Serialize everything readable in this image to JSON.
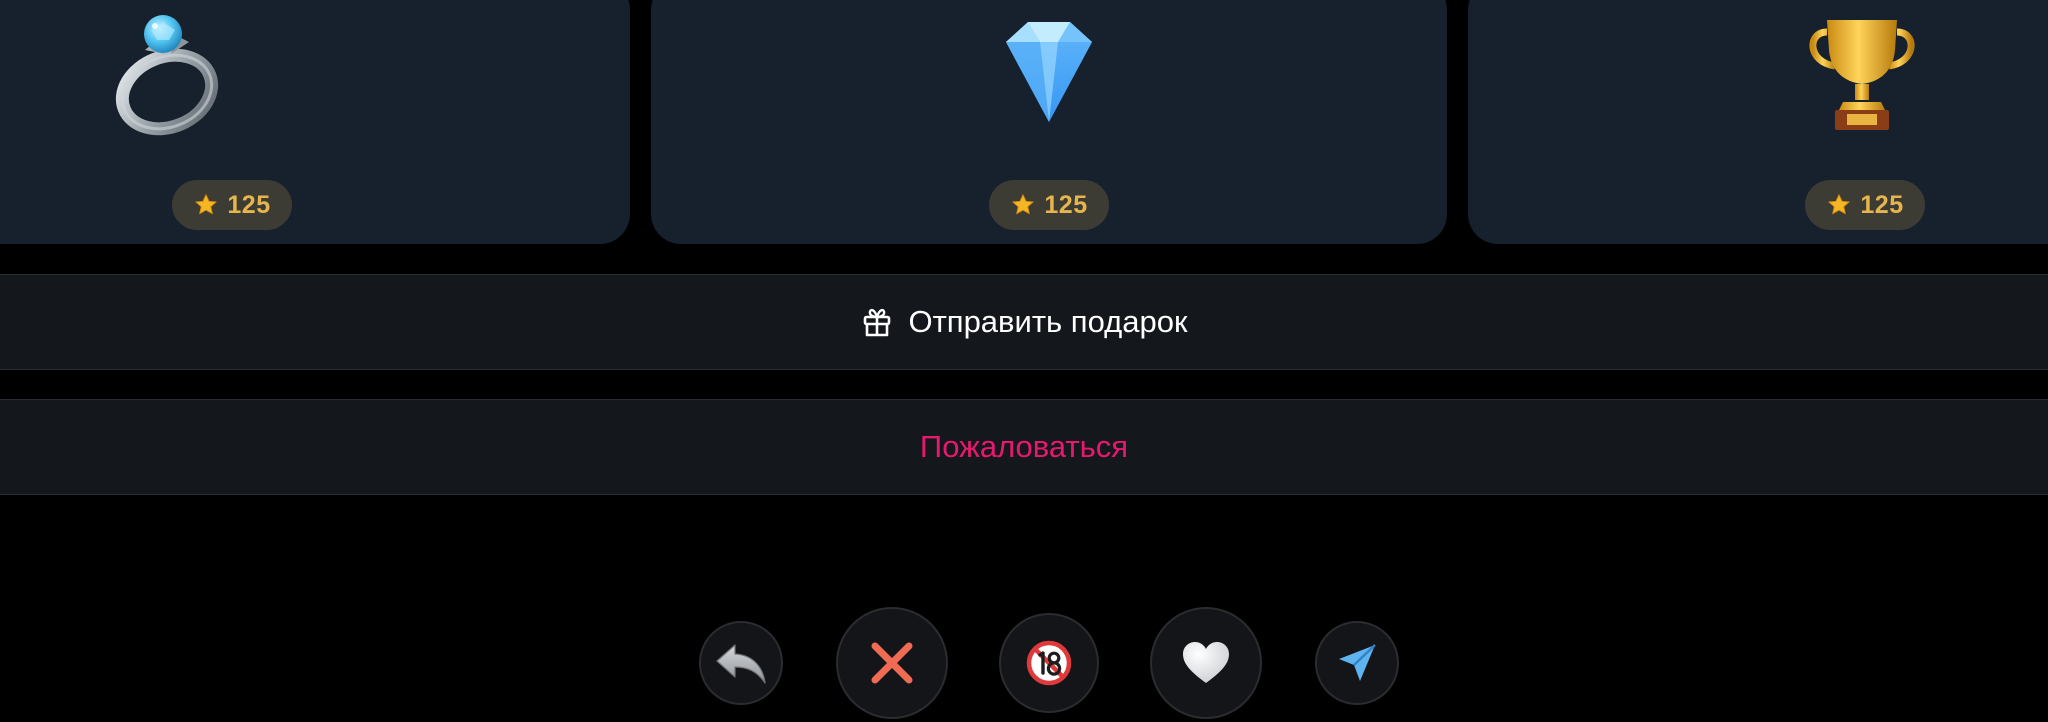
{
  "gifts": [
    {
      "icon": "ring-icon",
      "price": "125"
    },
    {
      "icon": "gem-icon",
      "price": "125"
    },
    {
      "icon": "trophy-icon",
      "price": "125"
    }
  ],
  "actions": {
    "send_gift_label": "Отправить подарок",
    "report_label": "Пожаловаться"
  },
  "controls": [
    {
      "icon": "reply-icon"
    },
    {
      "icon": "close-icon"
    },
    {
      "icon": "no-under-18-icon"
    },
    {
      "icon": "heart-icon"
    },
    {
      "icon": "send-icon"
    }
  ],
  "colors": {
    "background": "#000000",
    "card": "#17202d",
    "price_pill": "#3c3c34",
    "price_text": "#e7b54e",
    "report_text": "#e8186e",
    "close_red": "#f06b54",
    "send_blue": "#5fb3f0"
  }
}
